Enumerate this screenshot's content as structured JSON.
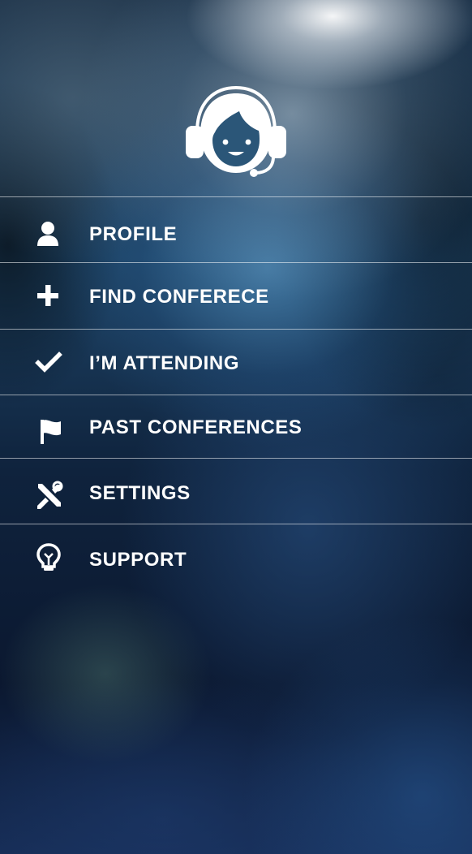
{
  "header": {
    "avatar_icon": "support-agent-headset-icon"
  },
  "menu": {
    "items": [
      {
        "label": "PROFILE",
        "icon": "person-icon"
      },
      {
        "label": "FIND CONFERECE",
        "icon": "plus-icon"
      },
      {
        "label": "I’M ATTENDING",
        "icon": "checkmark-icon"
      },
      {
        "label": "PAST CONFERENCES",
        "icon": "flag-icon"
      },
      {
        "label": "SETTINGS",
        "icon": "wrench-screwdriver-icon"
      },
      {
        "label": "SUPPORT",
        "icon": "lightbulb-icon"
      }
    ]
  },
  "colors": {
    "text": "#ffffff",
    "divider": "#c8d4de",
    "background_dark": "#0b1830",
    "background_blue": "#1e4466"
  }
}
